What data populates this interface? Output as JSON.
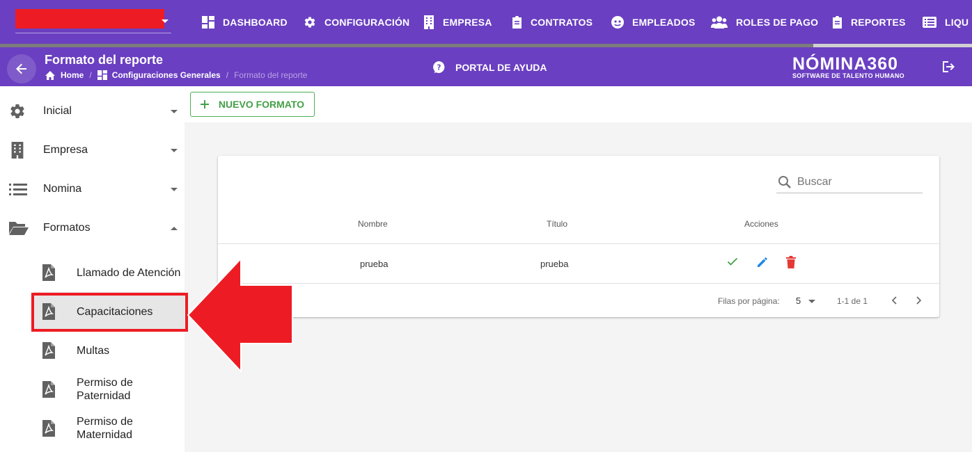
{
  "topbar": {
    "nav": [
      {
        "label": "DASHBOARD",
        "icon": "dashboard-icon"
      },
      {
        "label": "CONFIGURACIÓN",
        "icon": "gear-icon"
      },
      {
        "label": "EMPRESA",
        "icon": "building-icon"
      },
      {
        "label": "CONTRATOS",
        "icon": "clipboard-icon"
      },
      {
        "label": "EMPLEADOS",
        "icon": "people-face-icon"
      },
      {
        "label": "ROLES DE PAGO",
        "icon": "users-group-icon"
      },
      {
        "label": "REPORTES",
        "icon": "clipboard-icon"
      },
      {
        "label": "LIQU",
        "icon": "list-icon"
      }
    ]
  },
  "subbar": {
    "title": "Formato del reporte",
    "breadcrumb": [
      "Home",
      "Configuraciones Generales",
      "Formato del reporte"
    ],
    "help_label": "PORTAL DE AYUDA",
    "logo_main": "NÓMINA360",
    "logo_sub": "SOFTWARE DE TALENTO HUMANO"
  },
  "sidebar": {
    "items": [
      {
        "label": "Inicial",
        "icon": "gear-icon"
      },
      {
        "label": "Empresa",
        "icon": "building-icon"
      },
      {
        "label": "Nomina",
        "icon": "list-icon"
      },
      {
        "label": "Formatos",
        "icon": "folder-open-icon"
      }
    ],
    "sub_items": [
      {
        "label": "Llamado de Atención"
      },
      {
        "label": "Capacitaciones",
        "active": true
      },
      {
        "label": "Multas"
      },
      {
        "label": "Permiso de Paternidad"
      },
      {
        "label": "Permiso de Maternidad"
      }
    ]
  },
  "main": {
    "new_button": "NUEVO FORMATO",
    "search_placeholder": "Buscar",
    "columns": [
      "Nombre",
      "Título",
      "Acciones"
    ],
    "rows": [
      {
        "nombre": "prueba",
        "titulo": "prueba"
      }
    ],
    "footer": {
      "rows_per_page_label": "Filas por página:",
      "rows_per_page": "5",
      "range": "1-1 de 1"
    }
  },
  "colors": {
    "header": "#6a3fc1",
    "accent_green": "#43a047",
    "edit_blue": "#1e88e5",
    "delete_red": "#e53935",
    "annotation_red": "#ed1c24"
  }
}
